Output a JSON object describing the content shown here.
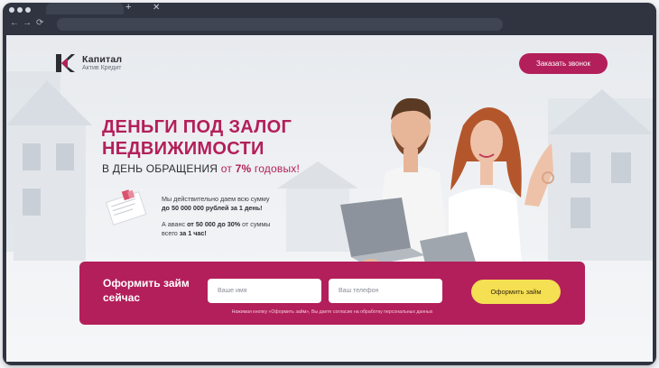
{
  "browser": {
    "tab_close": "✕",
    "new_tab": "+",
    "nav_back": "←",
    "nav_forward": "→",
    "nav_reload": "⟳"
  },
  "logo": {
    "name": "Капитал",
    "subtitle": "Актив Кредит",
    "mark": "K",
    "colors": {
      "dark": "#2b2d33",
      "accent": "#b31f5a"
    }
  },
  "header": {
    "call_button": "Заказать звонок"
  },
  "hero": {
    "title_line1": "ДЕНЬГИ ПОД ЗАЛОГ",
    "title_line2": "НЕДВИЖИМОСТИ",
    "subtitle_part1": "В ДЕНЬ ОБРАЩЕНИЯ",
    "subtitle_part2": "от",
    "subtitle_rate": "7%",
    "subtitle_part3": "годовых!"
  },
  "info": {
    "line1": "Мы действительно даем всю сумму",
    "line1_bold": "до 50 000 000 рублей за 1 день!",
    "line2_start": "А аванс",
    "line2_bold": "от 50 000 до 30%",
    "line2_end": "от суммы",
    "line3_start": "всего",
    "line3_bold": "за 1 час!"
  },
  "form": {
    "title": "Оформить займ сейчас",
    "name_placeholder": "Ваше имя",
    "phone_placeholder": "Ваш телефон",
    "submit": "Оформить займ",
    "consent": "Нажимая кнопку «Оформить займ», Вы даете согласие на обработку персональных данных"
  },
  "colors": {
    "brand": "#b31f5a",
    "cta": "#f5df52",
    "chrome": "#2f3440"
  }
}
